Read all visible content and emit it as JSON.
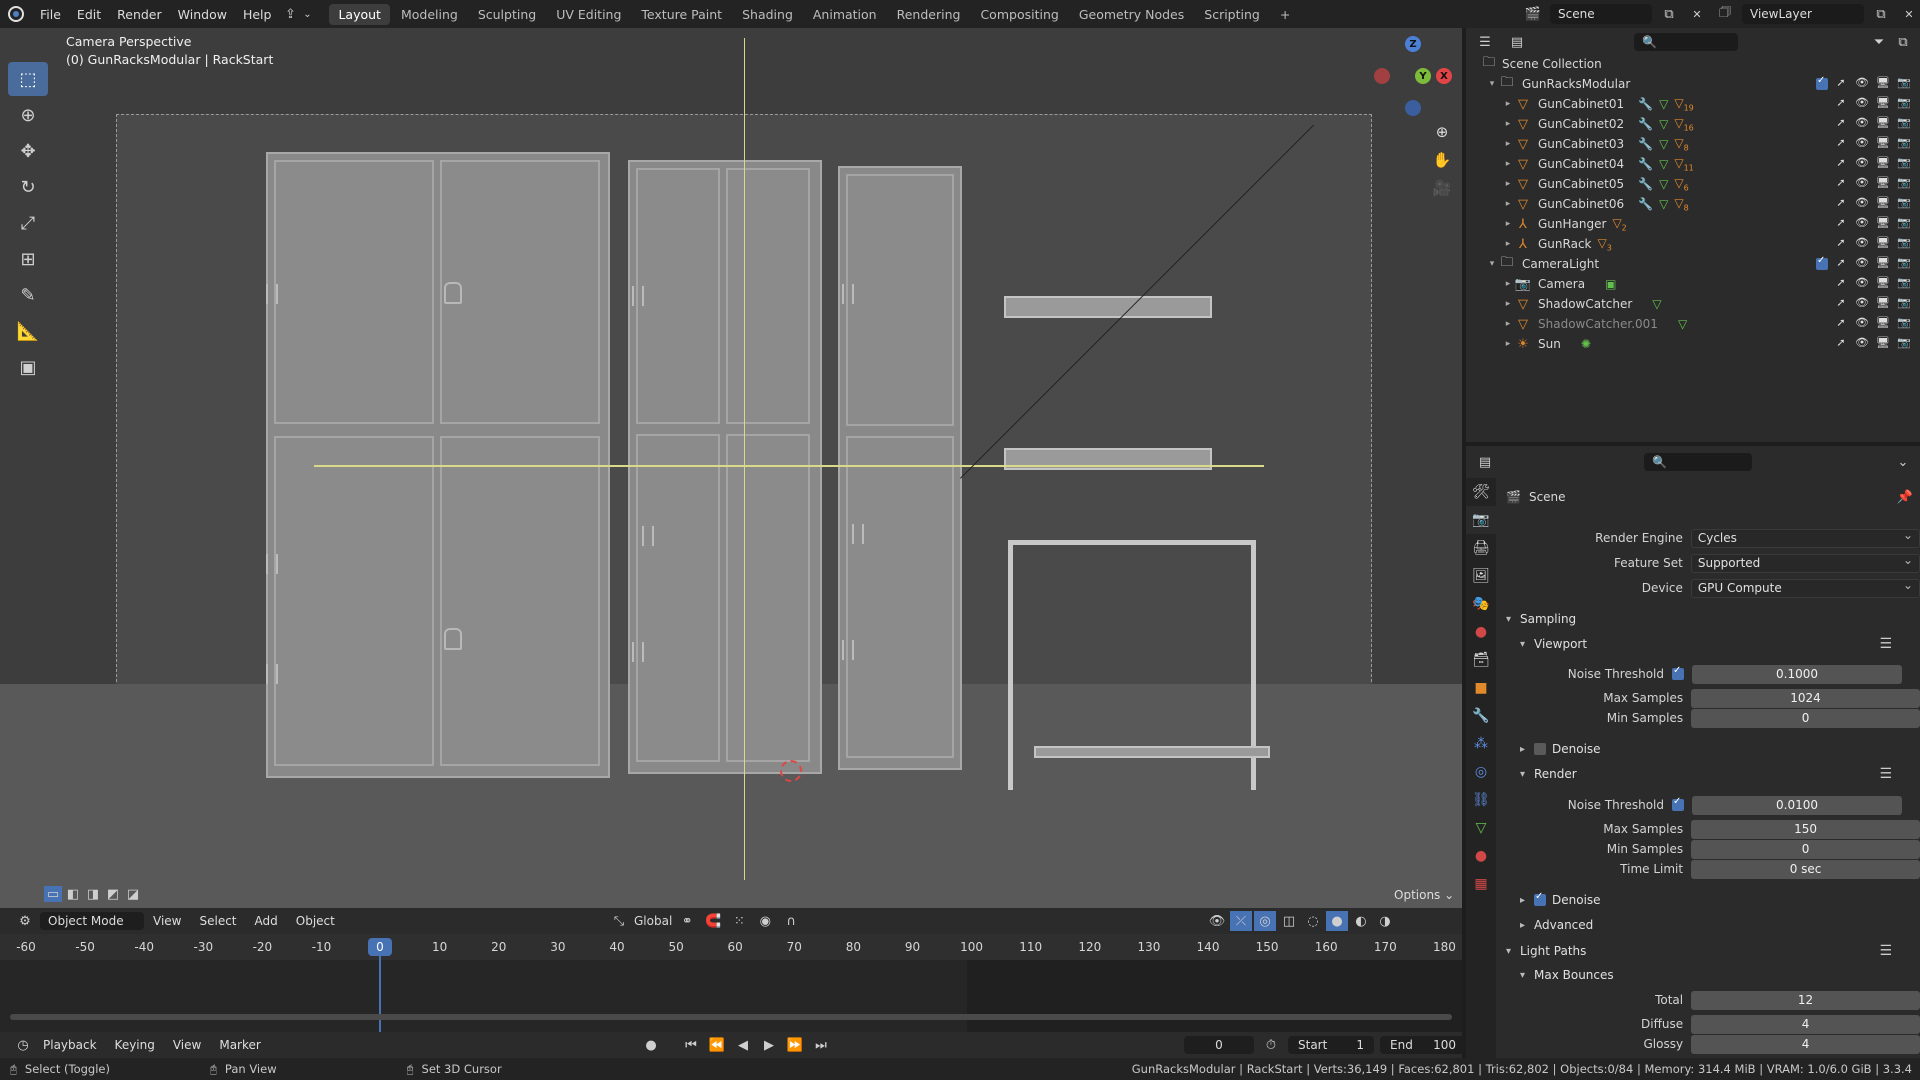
{
  "menu": {
    "items": [
      "File",
      "Edit",
      "Render",
      "Window",
      "Help"
    ]
  },
  "workspaces": [
    {
      "label": "Layout",
      "active": true
    },
    {
      "label": "Modeling"
    },
    {
      "label": "Sculpting"
    },
    {
      "label": "UV Editing"
    },
    {
      "label": "Texture Paint"
    },
    {
      "label": "Shading"
    },
    {
      "label": "Animation"
    },
    {
      "label": "Rendering"
    },
    {
      "label": "Compositing"
    },
    {
      "label": "Geometry Nodes"
    },
    {
      "label": "Scripting"
    }
  ],
  "header": {
    "scene": "Scene",
    "view_layer": "ViewLayer",
    "add_workspace": "+"
  },
  "viewport": {
    "mode_line1": "Camera Perspective",
    "mode_line2": "(0) GunRacksModular | RackStart",
    "gizmo": {
      "z": "Z",
      "y": "Y",
      "x": "X"
    },
    "options_label": "Options"
  },
  "viewport_header": {
    "mode": "Object Mode",
    "items": [
      "View",
      "Select",
      "Add",
      "Object"
    ],
    "orientation": "Global"
  },
  "timeline": {
    "ticks": [
      -60,
      -50,
      -40,
      -30,
      -20,
      -10,
      0,
      10,
      20,
      30,
      40,
      50,
      60,
      70,
      80,
      90,
      100,
      110,
      120,
      130,
      140,
      150,
      160,
      170,
      180
    ],
    "current_frame": "0",
    "menu": [
      "Playback",
      "Keying",
      "View",
      "Marker"
    ],
    "frame_value": "0",
    "start_label": "Start",
    "start_value": "1",
    "end_label": "End",
    "end_value": "100"
  },
  "status": {
    "left1": "Select (Toggle)",
    "left2": "Pan View",
    "left3": "Set 3D Cursor",
    "right": "GunRacksModular | RackStart | Verts:36,149 | Faces:62,801 | Tris:62,802 | Objects:0/84 | Memory: 314.4 MiB | VRAM: 1.0/6.0 GiB | 3.3.4"
  },
  "outliner": {
    "root": "Scene Collection",
    "rows": [
      {
        "label": "GunRacksModular",
        "type": "collection",
        "level": 1
      },
      {
        "label": "GunCabinet01",
        "type": "mesh",
        "level": 2,
        "count": "19"
      },
      {
        "label": "GunCabinet02",
        "type": "mesh",
        "level": 2,
        "count": "16"
      },
      {
        "label": "GunCabinet03",
        "type": "mesh",
        "level": 2,
        "count": "8"
      },
      {
        "label": "GunCabinet04",
        "type": "mesh",
        "level": 2,
        "count": "11"
      },
      {
        "label": "GunCabinet05",
        "type": "mesh",
        "level": 2,
        "count": "6"
      },
      {
        "label": "GunCabinet06",
        "type": "mesh",
        "level": 2,
        "count": "8"
      },
      {
        "label": "GunHanger",
        "type": "empty",
        "level": 2,
        "count": "2"
      },
      {
        "label": "GunRack",
        "type": "empty",
        "level": 2,
        "count": "3"
      },
      {
        "label": "CameraLight",
        "type": "collection",
        "level": 1
      },
      {
        "label": "Camera",
        "type": "camera",
        "level": 2
      },
      {
        "label": "ShadowCatcher",
        "type": "mesh",
        "level": 2
      },
      {
        "label": "ShadowCatcher.001",
        "type": "mesh",
        "level": 2,
        "dim": true
      },
      {
        "label": "Sun",
        "type": "light",
        "level": 2
      }
    ]
  },
  "properties": {
    "title": "Scene",
    "render_engine": {
      "label": "Render Engine",
      "value": "Cycles"
    },
    "feature_set": {
      "label": "Feature Set",
      "value": "Supported"
    },
    "device": {
      "label": "Device",
      "value": "GPU Compute"
    },
    "sampling": "Sampling",
    "viewport": "Viewport",
    "vp_noise": {
      "label": "Noise Threshold",
      "value": "0.1000"
    },
    "vp_max": {
      "label": "Max Samples",
      "value": "1024"
    },
    "vp_min": {
      "label": "Min Samples",
      "value": "0"
    },
    "denoise": "Denoise",
    "render": "Render",
    "r_noise": {
      "label": "Noise Threshold",
      "value": "0.0100"
    },
    "r_max": {
      "label": "Max Samples",
      "value": "150"
    },
    "r_min": {
      "label": "Min Samples",
      "value": "0"
    },
    "r_time": {
      "label": "Time Limit",
      "value": "0 sec"
    },
    "advanced": "Advanced",
    "light_paths": "Light Paths",
    "max_bounces": "Max Bounces",
    "total": {
      "label": "Total",
      "value": "12"
    },
    "diffuse": {
      "label": "Diffuse",
      "value": "4"
    },
    "glossy": {
      "label": "Glossy",
      "value": "4"
    }
  },
  "colors": {
    "accent": "#4772b3",
    "x_axis": "#e24545",
    "y_axis": "#7dbb3b",
    "z_axis": "#4c7fd6"
  }
}
